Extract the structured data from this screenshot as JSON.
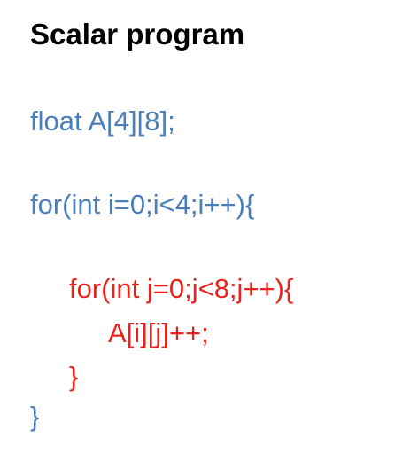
{
  "title": "Scalar program",
  "colors": {
    "outer_code": "#4a7ebb",
    "inner_code": "#e8231d",
    "title": "#000000"
  },
  "code": {
    "declaration": "float A[4][8];",
    "outer_loop": "for(int i=0;i<4;i++){",
    "inner_loop": "for(int j=0;j<8;j++){",
    "inner_body": "A[i][j]++;",
    "inner_close": "}",
    "outer_close": "}"
  }
}
